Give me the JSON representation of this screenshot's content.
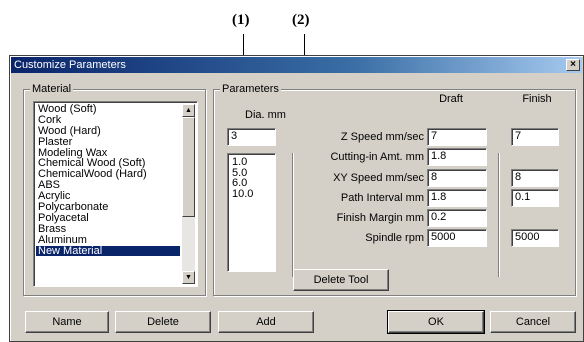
{
  "callouts": {
    "one": "(1)",
    "two": "(2)"
  },
  "window": {
    "title": "Customize Parameters",
    "close": "×"
  },
  "material": {
    "legend": "Material",
    "items": [
      "Wood (Soft)",
      "Cork",
      "Wood (Hard)",
      "Plaster",
      "Modeling Wax",
      "Chemical Wood (Soft)",
      "ChemicalWood (Hard)",
      "ABS",
      "Acrylic",
      "Polycarbonate",
      "Polyacetal",
      "Brass",
      "Aluminum",
      "New Material"
    ],
    "selected": "New Material"
  },
  "parameters": {
    "legend": "Parameters",
    "dia_label": "Dia. mm",
    "dia_value": "3",
    "tool_list": [
      "1.0",
      "5.0",
      "6.0",
      "10.0"
    ],
    "draft_header": "Draft",
    "finish_header": "Finish",
    "rows": [
      {
        "label": "Z Speed mm/sec",
        "draft": "7",
        "finish": "7"
      },
      {
        "label": "Cutting-in Amt. mm",
        "draft": "1.8",
        "finish": ""
      },
      {
        "label": "XY Speed mm/sec",
        "draft": "8",
        "finish": "8"
      },
      {
        "label": "Path Interval mm",
        "draft": "1.8",
        "finish": "0.1"
      },
      {
        "label": "Finish Margin mm",
        "draft": "0.2",
        "finish": ""
      },
      {
        "label": "Spindle rpm",
        "draft": "5000",
        "finish": "5000"
      }
    ],
    "delete_tool": "Delete Tool"
  },
  "buttons": {
    "name": "Name",
    "delete": "Delete",
    "add": "Add",
    "ok": "OK",
    "cancel": "Cancel"
  },
  "colors": {
    "title_start": "#0a246a",
    "title_end": "#a6caf0",
    "face": "#d4d0c8",
    "selection": "#0a246a"
  }
}
